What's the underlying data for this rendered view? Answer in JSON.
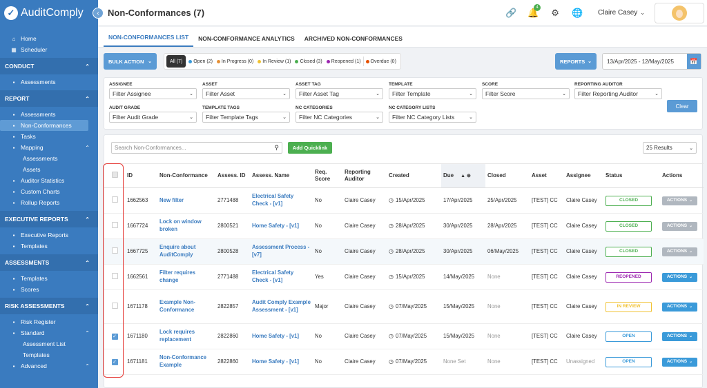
{
  "brand": {
    "name": "AuditComply",
    "logo_glyph": "✓"
  },
  "page_title": "Non-Conformances (7)",
  "sidebar": {
    "top_items": [
      {
        "label": "Home",
        "icon": "home-icon"
      },
      {
        "label": "Scheduler",
        "icon": "calendar-icon"
      }
    ],
    "sections": [
      {
        "title": "CONDUCT",
        "items": [
          {
            "label": "Assessments",
            "sub": false
          }
        ]
      },
      {
        "title": "REPORT",
        "items": [
          {
            "label": "Assessments",
            "sub": false
          },
          {
            "label": "Non-Conformances",
            "sub": false,
            "active": true
          },
          {
            "label": "Tasks",
            "sub": false
          },
          {
            "label": "Mapping",
            "sub": false,
            "expandable": true
          },
          {
            "label": "Assessments",
            "sub": true
          },
          {
            "label": "Assets",
            "sub": true
          },
          {
            "label": "Auditor Statistics",
            "sub": false
          },
          {
            "label": "Custom Charts",
            "sub": false
          },
          {
            "label": "Rollup Reports",
            "sub": false
          }
        ]
      },
      {
        "title": "EXECUTIVE REPORTS",
        "items": [
          {
            "label": "Executive Reports",
            "sub": false
          },
          {
            "label": "Templates",
            "sub": false
          }
        ]
      },
      {
        "title": "ASSESSMENTS",
        "items": [
          {
            "label": "Templates",
            "sub": false
          },
          {
            "label": "Scores",
            "sub": false
          }
        ]
      },
      {
        "title": "RISK ASSESSMENTS",
        "items": [
          {
            "label": "Risk Register",
            "sub": false
          },
          {
            "label": "Standard",
            "sub": false,
            "expandable": true
          },
          {
            "label": "Assessment List",
            "sub": true
          },
          {
            "label": "Templates",
            "sub": true
          },
          {
            "label": "Advanced",
            "sub": false,
            "expandable": true
          }
        ]
      }
    ]
  },
  "header": {
    "user_name": "Claire Casey",
    "notification_count": "4"
  },
  "tabs": [
    {
      "label": "NON-CONFORMANCES LIST",
      "active": true
    },
    {
      "label": "NON-CONFORMANCE ANALYTICS",
      "active": false
    },
    {
      "label": "ARCHIVED NON-CONFORMANCES",
      "active": false
    }
  ],
  "toolbar": {
    "bulk_action": "BULK ACTION",
    "reports": "REPORTS",
    "date_range": "13/Apr/2025 - 12/May/2025",
    "status_filters": [
      {
        "label": "All (7)",
        "color": "",
        "active": true
      },
      {
        "label": "Open (2)",
        "color": "#3a9ad9"
      },
      {
        "label": "In Progress (0)",
        "color": "#e69138"
      },
      {
        "label": "In Review (1)",
        "color": "#f1c232"
      },
      {
        "label": "Closed (3)",
        "color": "#4caf50"
      },
      {
        "label": "Reopened (1)",
        "color": "#9c27b0"
      },
      {
        "label": "Overdue (0)",
        "color": "#e65100"
      }
    ]
  },
  "filters": {
    "row1": [
      {
        "label": "ASSIGNEE",
        "placeholder": "Filter Assignee"
      },
      {
        "label": "ASSET",
        "placeholder": "Filter Asset"
      },
      {
        "label": "ASSET TAG",
        "placeholder": "Filter Asset Tag"
      },
      {
        "label": "TEMPLATE",
        "placeholder": "Filter Template"
      },
      {
        "label": "SCORE",
        "placeholder": "Filter Score"
      },
      {
        "label": "REPORTING AUDITOR",
        "placeholder": "Filter Reporting Auditor"
      }
    ],
    "row2": [
      {
        "label": "AUDIT GRADE",
        "placeholder": "Filter Audit Grade"
      },
      {
        "label": "TEMPLATE TAGS",
        "placeholder": "Filter Template Tags"
      },
      {
        "label": "NC CATEGORIES",
        "placeholder": "Filter NC Categories"
      },
      {
        "label": "NC CATEGORY LISTS",
        "placeholder": "Filter NC Category Lists"
      }
    ],
    "clear": "Clear"
  },
  "table": {
    "search_placeholder": "Search Non-Conformances...",
    "quicklink": "Add Quicklink",
    "results": "25 Results",
    "columns": [
      "ID",
      "Non-Conformance",
      "Assess. ID",
      "Assess. Name",
      "Req. Score",
      "Reporting Auditor",
      "Created",
      "Due",
      "Closed",
      "Asset",
      "Assignee",
      "Status",
      "Actions"
    ],
    "rows": [
      {
        "checked": false,
        "id": "1662563",
        "nc": "New filter",
        "assess_id": "2771488",
        "assess_name": "Electrical Safety Check - [v1]",
        "score": "No",
        "auditor": "Claire Casey",
        "created": "15/Apr/2025",
        "due": "17/Apr/2025",
        "due_muted": false,
        "closed": "25/Apr/2025",
        "closed_muted": false,
        "asset": "[TEST] CC",
        "assignee": "Claire Casey",
        "assignee_muted": false,
        "status": "CLOSED",
        "status_color": "#4caf50",
        "actions": "ACTIONS",
        "actions_color": "#b0b7bf",
        "highlight": false
      },
      {
        "checked": false,
        "id": "1667724",
        "nc": "Lock on window broken",
        "assess_id": "2800521",
        "assess_name": "Home Safety - [v1]",
        "score": "No",
        "auditor": "Claire Casey",
        "created": "28/Apr/2025",
        "due": "30/Apr/2025",
        "due_muted": false,
        "closed": "28/Apr/2025",
        "closed_muted": false,
        "asset": "[TEST] CC",
        "assignee": "Claire Casey",
        "assignee_muted": false,
        "status": "CLOSED",
        "status_color": "#4caf50",
        "actions": "ACTIONS",
        "actions_color": "#b0b7bf",
        "highlight": false
      },
      {
        "checked": false,
        "id": "1667725",
        "nc": "Enquire about AuditComply",
        "assess_id": "2800528",
        "assess_name": "Assessment Process - [v7]",
        "score": "No",
        "auditor": "Claire Casey",
        "created": "28/Apr/2025",
        "due": "30/Apr/2025",
        "due_muted": false,
        "closed": "06/May/2025",
        "closed_muted": false,
        "asset": "[TEST] CC",
        "assignee": "Claire Casey",
        "assignee_muted": false,
        "status": "CLOSED",
        "status_color": "#4caf50",
        "actions": "ACTIONS",
        "actions_color": "#b0b7bf",
        "highlight": true
      },
      {
        "checked": false,
        "id": "1662561",
        "nc": "Filter requires change",
        "assess_id": "2771488",
        "assess_name": "Electrical Safety Check - [v1]",
        "score": "Yes",
        "auditor": "Claire Casey",
        "created": "15/Apr/2025",
        "due": "14/May/2025",
        "due_muted": false,
        "closed": "None",
        "closed_muted": true,
        "asset": "[TEST] CC",
        "assignee": "Claire Casey",
        "assignee_muted": false,
        "status": "REOPENED",
        "status_color": "#9c27b0",
        "actions": "ACTIONS",
        "actions_color": "#3a9ad9",
        "highlight": false
      },
      {
        "checked": false,
        "id": "1671178",
        "nc": "Example Non-Conformance",
        "assess_id": "2822857",
        "assess_name": "Audit Comply Example Assessment - [v1]",
        "score": "Major",
        "auditor": "Claire Casey",
        "created": "07/May/2025",
        "due": "15/May/2025",
        "due_muted": false,
        "closed": "None",
        "closed_muted": true,
        "asset": "[TEST] CC",
        "assignee": "Claire Casey",
        "assignee_muted": false,
        "status": "IN REVIEW",
        "status_color": "#f1c232",
        "actions": "ACTIONS",
        "actions_color": "#3a9ad9",
        "highlight": false
      },
      {
        "checked": true,
        "id": "1671180",
        "nc": "Lock requires replacement",
        "assess_id": "2822860",
        "assess_name": "Home Safety - [v1]",
        "score": "No",
        "auditor": "Claire Casey",
        "created": "07/May/2025",
        "due": "15/May/2025",
        "due_muted": false,
        "closed": "None",
        "closed_muted": true,
        "asset": "[TEST] CC",
        "assignee": "Claire Casey",
        "assignee_muted": false,
        "status": "OPEN",
        "status_color": "#3a9ad9",
        "actions": "ACTIONS",
        "actions_color": "#3a9ad9",
        "highlight": false
      },
      {
        "checked": true,
        "id": "1671181",
        "nc": "Non-Conformance Example",
        "assess_id": "2822860",
        "assess_name": "Home Safety - [v1]",
        "score": "No",
        "auditor": "Claire Casey",
        "created": "07/May/2025",
        "due": "None Set",
        "due_muted": true,
        "closed": "None",
        "closed_muted": true,
        "asset": "[TEST] CC",
        "assignee": "Unassigned",
        "assignee_muted": true,
        "status": "OPEN",
        "status_color": "#3a9ad9",
        "actions": "ACTIONS",
        "actions_color": "#3a9ad9",
        "highlight": false
      }
    ]
  }
}
